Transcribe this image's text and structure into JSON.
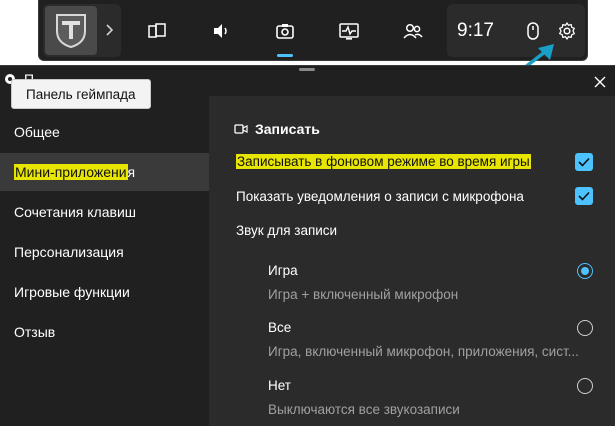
{
  "topbar": {
    "clock": "9:17",
    "icons": [
      "widget-menu-icon",
      "performance-icon",
      "audio-icon",
      "capture-icon",
      "resources-icon",
      "social-icon",
      "mouse-icon",
      "settings-icon"
    ]
  },
  "panel": {
    "header_partial": "П",
    "tooltip": "Панель геймпада",
    "sidebar": {
      "items": [
        {
          "label": "Общее"
        },
        {
          "label_highlighted": "Мини-приложени",
          "label_rest": "я"
        },
        {
          "label": "Сочетания клавиш"
        },
        {
          "label": "Персонализация"
        },
        {
          "label": "Игровые функции"
        },
        {
          "label": "Отзыв"
        }
      ]
    },
    "content": {
      "section_title": "Записать",
      "background_recording": {
        "label": "Записывать в фоновом режиме во время игры",
        "checked": true
      },
      "mic_notifications": {
        "label": "Показать уведомления о записи с микрофона",
        "checked": true
      },
      "audio_heading": "Звук для записи",
      "audio_options": [
        {
          "title": "Игра",
          "description": "Игра + включенный микрофон",
          "selected": true
        },
        {
          "title": "Все",
          "description": "Игра, включенный микрофон, приложения, сист...",
          "selected": false
        },
        {
          "title": "Нет",
          "description": "Выключаются все звукозаписи",
          "selected": false
        }
      ]
    }
  },
  "colors": {
    "accent": "#4cc2ff",
    "highlight": "#e8e600",
    "annotation_arrow": "#1aa0c8"
  }
}
